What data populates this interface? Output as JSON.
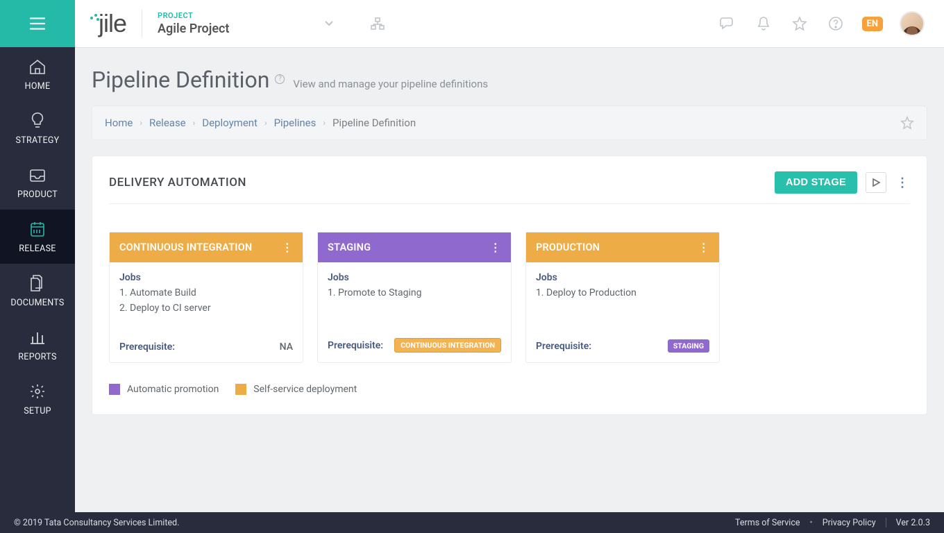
{
  "header": {
    "project_label": "PROJECT",
    "project_name": "Agile Project",
    "lang": "EN"
  },
  "sidebar": {
    "items": [
      {
        "label": "HOME"
      },
      {
        "label": "STRATEGY"
      },
      {
        "label": "PRODUCT"
      },
      {
        "label": "RELEASE"
      },
      {
        "label": "DOCUMENTS"
      },
      {
        "label": "REPORTS"
      },
      {
        "label": "SETUP"
      }
    ]
  },
  "page": {
    "title": "Pipeline Definition",
    "subtitle": "View and manage your pipeline definitions"
  },
  "breadcrumb": {
    "items": [
      "Home",
      "Release",
      "Deployment",
      "Pipelines"
    ],
    "current": "Pipeline Definition"
  },
  "panel": {
    "title": "DELIVERY AUTOMATION",
    "add_stage_label": "ADD STAGE",
    "jobs_label": "Jobs",
    "prereq_label": "Prerequisite:",
    "stages": [
      {
        "name": "CONTINUOUS INTEGRATION",
        "head_class": "orange-bg",
        "jobs": [
          "1. Automate Build",
          "2. Deploy to CI server"
        ],
        "prereq_text": "NA",
        "prereq_pill": null,
        "pill_class": null
      },
      {
        "name": "STAGING",
        "head_class": "purple-bg",
        "jobs": [
          "1. Promote to Staging"
        ],
        "prereq_text": null,
        "prereq_pill": "CONTINUOUS INTEGRATION",
        "pill_class": "pill-orange"
      },
      {
        "name": "PRODUCTION",
        "head_class": "orange-bg",
        "jobs": [
          "1. Deploy to Production"
        ],
        "prereq_text": null,
        "prereq_pill": "STAGING",
        "pill_class": "pill-purple"
      }
    ]
  },
  "legend": {
    "auto": "Automatic promotion",
    "self": "Self-service deployment"
  },
  "footer": {
    "copyright": "© 2019 Tata Consultancy Services Limited.",
    "tos": "Terms of Service",
    "privacy": "Privacy Policy",
    "version": "Ver 2.0.3"
  }
}
